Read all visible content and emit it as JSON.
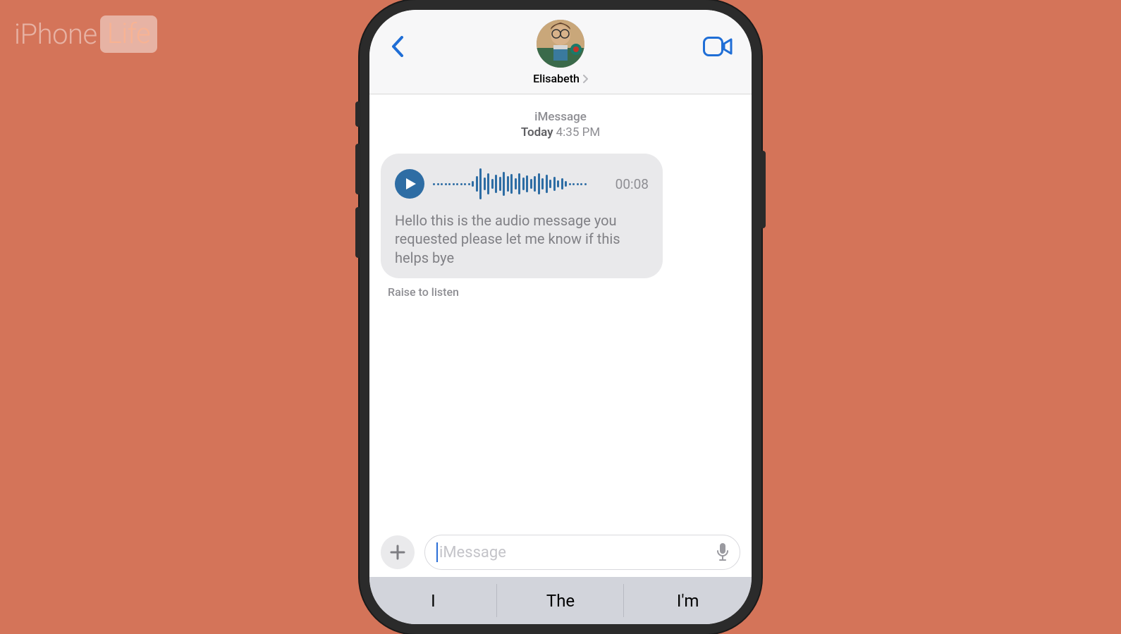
{
  "watermark": {
    "brand_prefix": "iPhone",
    "brand_box": "Life"
  },
  "header": {
    "contact_name": "Elisabeth"
  },
  "thread": {
    "service_label": "iMessage",
    "day_label": "Today",
    "time_label": "4:35 PM"
  },
  "message": {
    "duration": "00:08",
    "transcription": "Hello this is the audio message you requested please let me know if this helps bye",
    "raise_hint": "Raise to listen"
  },
  "compose": {
    "placeholder": "iMessage"
  },
  "suggestions": [
    "I",
    "The",
    "I'm"
  ]
}
